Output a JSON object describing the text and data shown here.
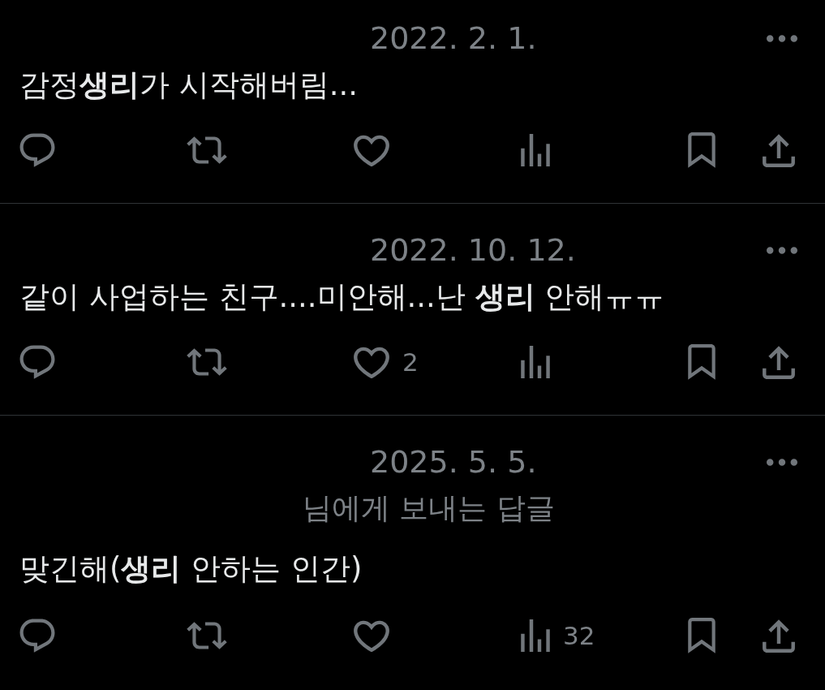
{
  "posts": [
    {
      "date": "2022. 2. 1.",
      "text": "감정**생리**가 시작해버림...",
      "actions": [
        {
          "kind": "reply"
        },
        {
          "kind": "repost"
        },
        {
          "kind": "like"
        },
        {
          "kind": "views"
        },
        {
          "kind": "bookmark"
        },
        {
          "kind": "share"
        }
      ]
    },
    {
      "date": "2022. 10. 12.",
      "text": "같이 사업하는 친구....미안해...난 **생리** 안해ㅠㅠ",
      "actions": [
        {
          "kind": "reply"
        },
        {
          "kind": "repost"
        },
        {
          "kind": "like",
          "count": "2"
        },
        {
          "kind": "views"
        },
        {
          "kind": "bookmark"
        },
        {
          "kind": "share"
        }
      ]
    },
    {
      "date": "2025. 5. 5.",
      "reply_to": "님에게 보내는 답글",
      "text": "맞긴해(**생리** 안하는 인간)",
      "actions": [
        {
          "kind": "reply"
        },
        {
          "kind": "repost"
        },
        {
          "kind": "like"
        },
        {
          "kind": "views",
          "count": "32"
        },
        {
          "kind": "bookmark"
        },
        {
          "kind": "share"
        }
      ]
    }
  ]
}
